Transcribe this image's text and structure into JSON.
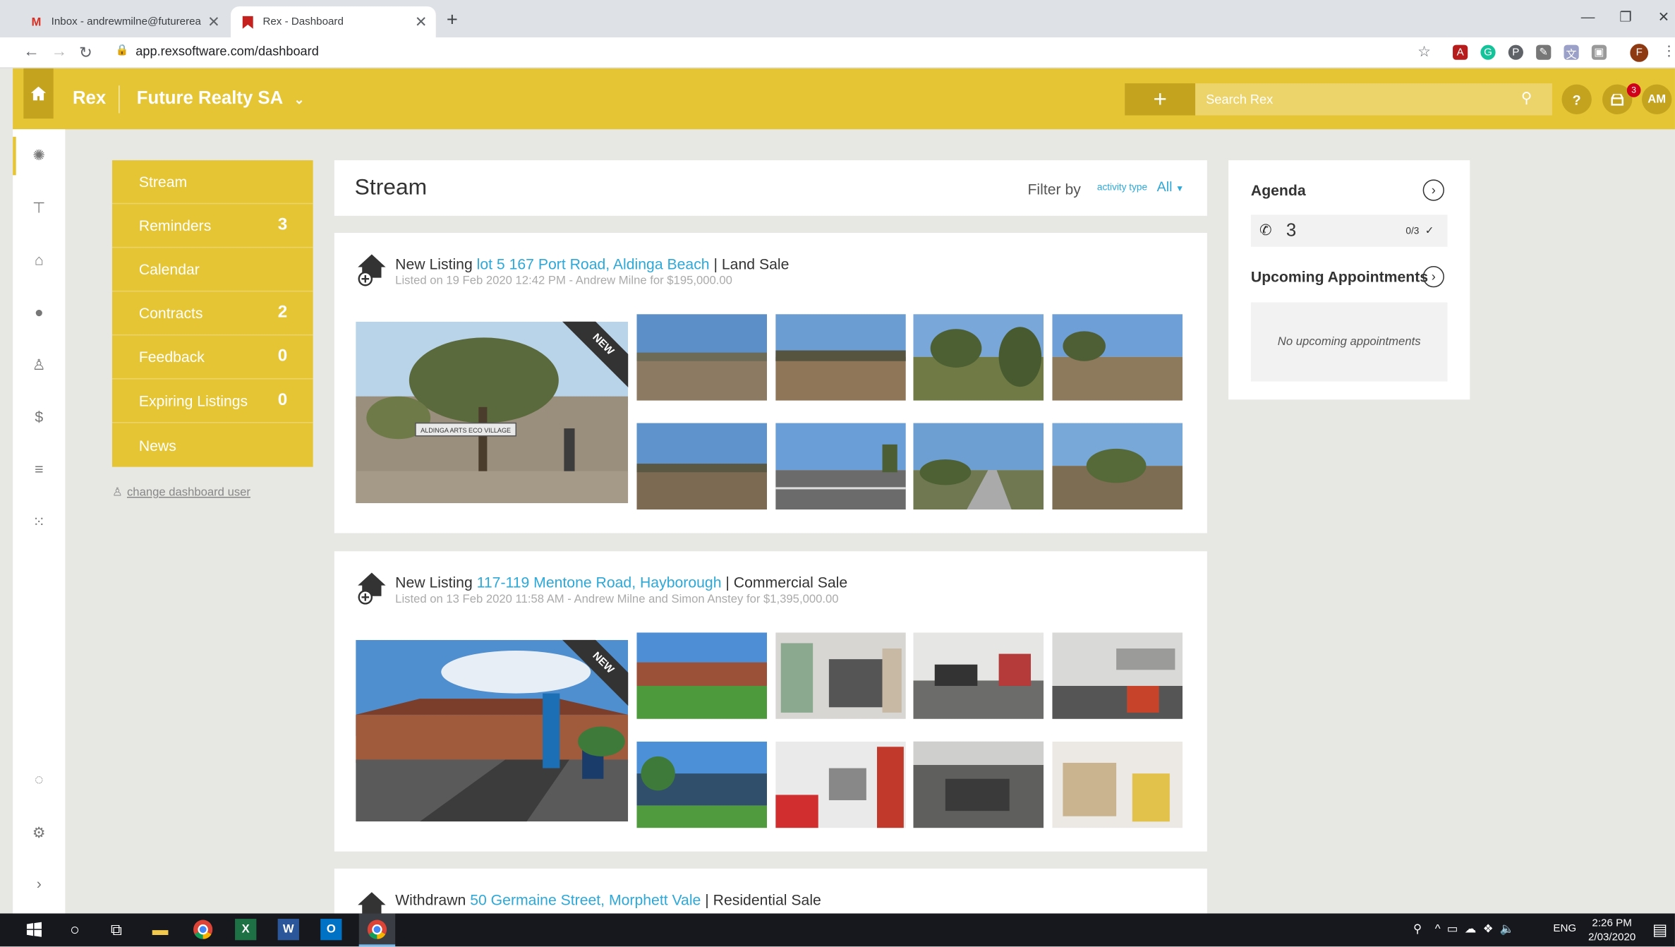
{
  "browser": {
    "tabs": [
      {
        "label": "Inbox - andrewmilne@futurereal",
        "icon": "gmail-icon"
      },
      {
        "label": "Rex - Dashboard",
        "icon": "rex-bookmark-icon"
      }
    ],
    "url": "app.rexsoftware.com/dashboard"
  },
  "header": {
    "brand": "Rex",
    "agency": "Future Realty SA",
    "search_placeholder": "Search Rex",
    "help_label": "?",
    "notification_count": "3",
    "user_initials": "AM"
  },
  "menu": {
    "items": [
      {
        "label": "Stream",
        "count": ""
      },
      {
        "label": "Reminders",
        "count": "3"
      },
      {
        "label": "Calendar",
        "count": ""
      },
      {
        "label": "Contracts",
        "count": "2"
      },
      {
        "label": "Feedback",
        "count": "0"
      },
      {
        "label": "Expiring Listings",
        "count": "0"
      },
      {
        "label": "News",
        "count": ""
      }
    ],
    "change_user": "change dashboard user"
  },
  "stream": {
    "title": "Stream",
    "filter_by": "Filter by",
    "activity_type": "activity type",
    "activity_value": "All",
    "cards": [
      {
        "type": "New Listing",
        "address": "lot 5 167 Port Road, Aldinga Beach",
        "category": "Land Sale",
        "meta": "Listed on 19 Feb 2020 12:42 PM - Andrew Milne for $195,000.00",
        "badge": "NEW",
        "sign": "ALDINGA ARTS ECO VILLAGE"
      },
      {
        "type": "New Listing",
        "address": "117-119 Mentone Road, Hayborough",
        "category": "Commercial Sale",
        "meta": "Listed on 13 Feb 2020 11:58 AM - Andrew Milne and Simon Anstey for $1,395,000.00",
        "badge": "NEW"
      },
      {
        "type": "Withdrawn",
        "address": "50 Germaine Street, Morphett Vale",
        "category": "Residential Sale"
      }
    ]
  },
  "agenda": {
    "title": "Agenda",
    "calls_count": "3",
    "calls_ratio": "0/3",
    "upcoming_title": "Upcoming Appointments",
    "no_appointments": "No upcoming appointments"
  },
  "taskbar": {
    "lang": "ENG",
    "time": "2:26 PM",
    "date": "2/03/2020"
  },
  "colors": {
    "brand_yellow": "#e5c533",
    "link_blue": "#2da8d8"
  }
}
